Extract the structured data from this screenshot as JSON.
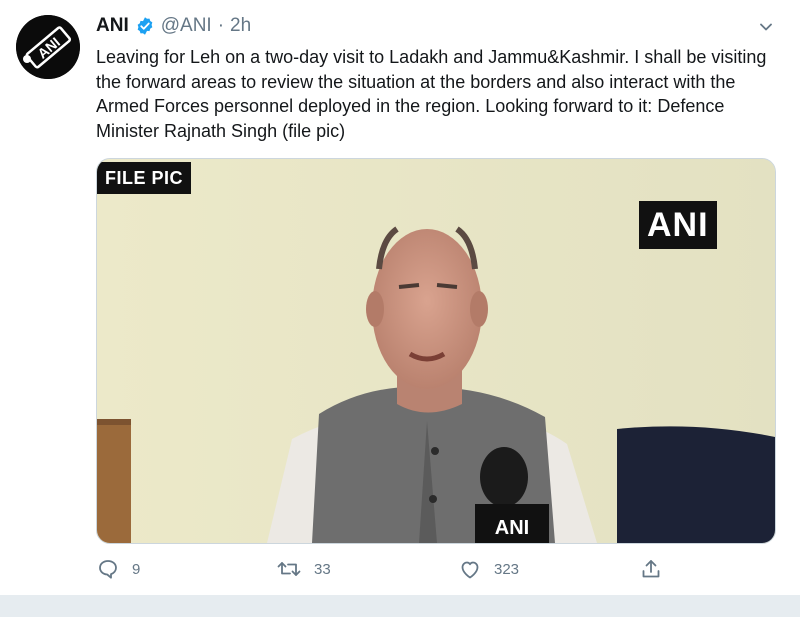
{
  "tweet": {
    "author_name": "ANI",
    "handle": "@ANI",
    "separator": "·",
    "time": "2h",
    "text": "Leaving for Leh on a two-day visit to Ladakh and Jammu&Kashmir. I shall be visiting the forward areas to review the situation at the borders and also interact with the Armed Forces personnel deployed in the region. Looking forward to it: Defence Minister Rajnath Singh (file pic)",
    "avatar_logo_text": "ANI",
    "media": {
      "file_pic_label": "FILE PIC",
      "watermark": "ANI",
      "microphone_logo_text": "ANI"
    },
    "actions": {
      "replies": "9",
      "retweets": "33",
      "likes": "323"
    }
  },
  "colors": {
    "verified_blue": "#1da1f2",
    "secondary_text": "#657786",
    "background_strip": "#e6ecf0"
  },
  "icons": [
    "verified-badge-icon",
    "chevron-down-icon",
    "reply-icon",
    "retweet-icon",
    "like-icon",
    "share-icon"
  ]
}
